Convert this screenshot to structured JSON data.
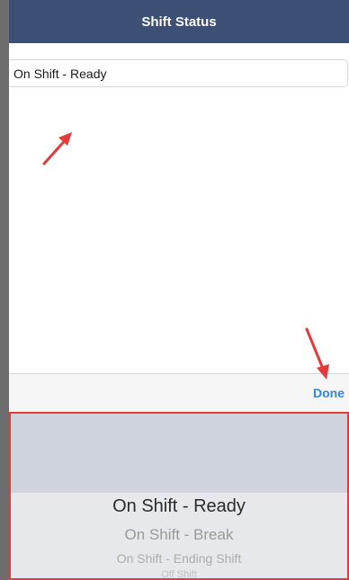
{
  "navbar": {
    "title": "Shift Status",
    "background": "#3c4f74"
  },
  "status_field": {
    "value": "On Shift - Ready"
  },
  "toolbar": {
    "done_label": "Done",
    "accent": "#2f86e0"
  },
  "picker": {
    "selected": "On Shift - Ready",
    "options": [
      "On Shift - Break",
      "On Shift - Ending Shift",
      "Off Shift"
    ],
    "highlight_border": "#e23b3b"
  },
  "annotations": {
    "arrow_color": "#e23b3b",
    "arrow_icon": "red-arrow-icon"
  }
}
